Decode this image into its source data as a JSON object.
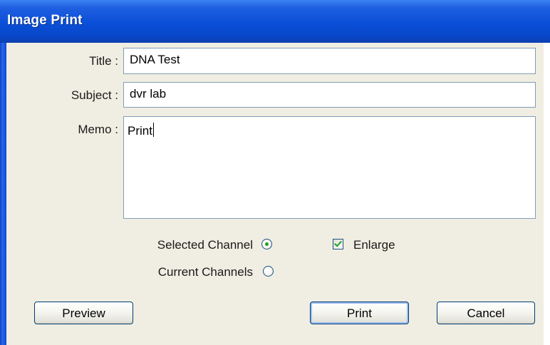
{
  "window": {
    "title": "Image Print"
  },
  "form": {
    "title_label": "Title :",
    "title_value": "DNA Test",
    "subject_label": "Subject :",
    "subject_value": "dvr lab",
    "memo_label": "Memo :",
    "memo_value": "Print"
  },
  "options": {
    "selected_channel_label": "Selected Channel",
    "selected_channel_checked": true,
    "current_channels_label": "Current Channels",
    "current_channels_checked": false,
    "enlarge_label": "Enlarge",
    "enlarge_checked": true
  },
  "buttons": {
    "preview": "Preview",
    "print": "Print",
    "cancel": "Cancel"
  },
  "colors": {
    "titlebar": "#0a4fd8",
    "client_background": "#f0eee2",
    "field_border": "#7f9db9",
    "check_accent": "#21a121"
  }
}
